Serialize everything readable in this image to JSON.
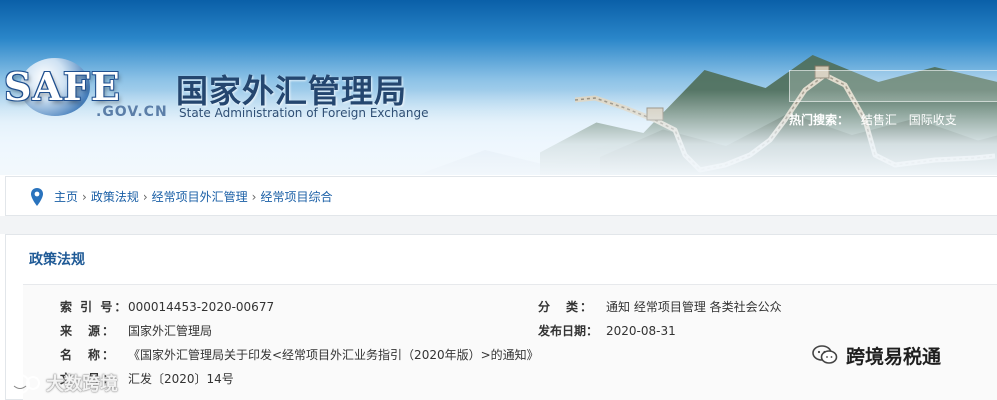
{
  "header": {
    "logo_text": "SAFE",
    "domain_text": ".GOV.CN",
    "site_title_cn": "国家外汇管理局",
    "site_title_en": "State Administration of Foreign Exchange",
    "hot_search_label": "热门搜索：",
    "hot_search_items": [
      "结售汇",
      "国际收支"
    ]
  },
  "breadcrumb": {
    "items": [
      "主页",
      "政策法规",
      "经常项目外汇管理",
      "经常项目综合"
    ],
    "separator": "›"
  },
  "panel": {
    "title": "政策法规",
    "fields": {
      "index_label": "索 引 号：",
      "index_value": "000014453-2020-00677",
      "category_label": "分　类：",
      "category_value": "通知  经常项目管理  各类社会公众",
      "source_label": "来　源：",
      "source_value": "国家外汇管理局",
      "date_label": "发布日期：",
      "date_value": "2020-08-31",
      "name_label": "名　称：",
      "name_value": "《国家外汇管理局关于印发<经常项目外汇业务指引（2020年版）>的通知》",
      "docno_label": "文　号：",
      "docno_value": "汇发〔2020〕14号"
    }
  },
  "watermarks": {
    "right_text": "跨境易税通",
    "left_text": "大数跨境"
  },
  "colors": {
    "link_blue": "#1a5fa6",
    "title_blue": "#1f5a96",
    "banner_navy": "#24466f"
  }
}
